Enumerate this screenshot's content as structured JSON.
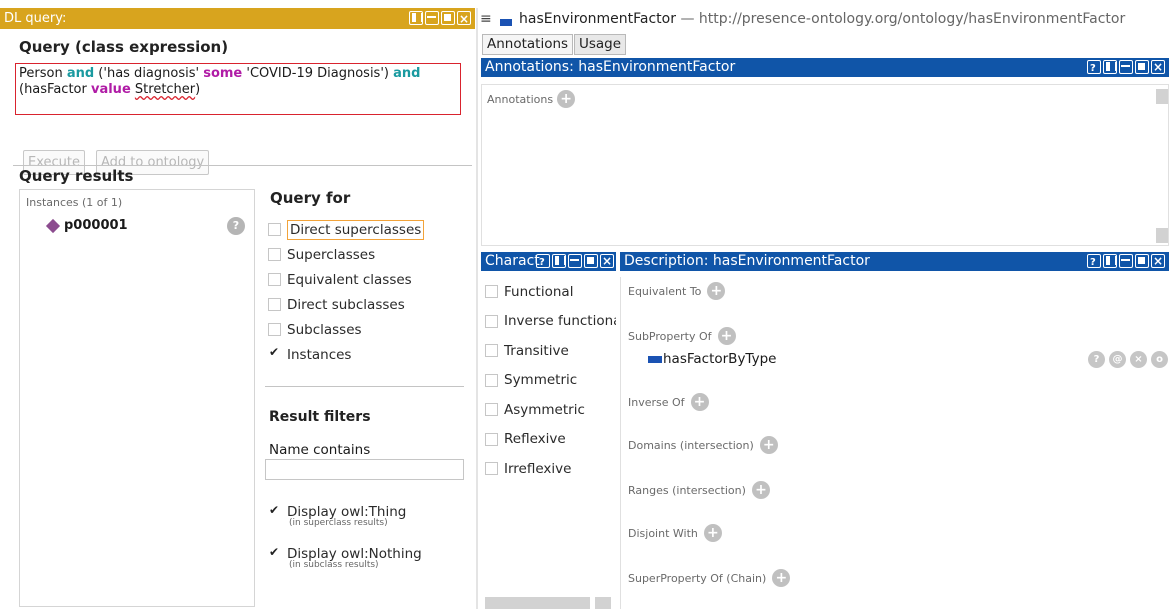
{
  "dl_query": {
    "title": "DL query:",
    "class_expression_heading": "Query (class expression)",
    "expression": {
      "t1": "Person ",
      "k1": "and",
      "t2": " ('has diagnosis' ",
      "k2": "some",
      "t3": " 'COVID-19 Diagnosis') ",
      "k3": "and",
      "t4": "(hasFactor ",
      "k4": "value",
      "t5": " ",
      "t6": "Stretcher",
      "t7": ")"
    },
    "execute_label": "Execute",
    "add_label": "Add to ontology",
    "results_heading": "Query results",
    "instances_header": "Instances (1 of 1)",
    "result_item": "p000001",
    "help_glyph": "?",
    "query_for_heading": "Query for",
    "query_for": [
      {
        "label": "Direct superclasses",
        "checked": false
      },
      {
        "label": "Superclasses",
        "checked": false
      },
      {
        "label": "Equivalent classes",
        "checked": false
      },
      {
        "label": "Direct subclasses",
        "checked": false
      },
      {
        "label": "Subclasses",
        "checked": false
      },
      {
        "label": "Instances",
        "checked": true
      }
    ],
    "result_filters_heading": "Result filters",
    "name_contains_label": "Name contains",
    "name_contains_value": "",
    "display_thing_label": "Display owl:Thing",
    "display_thing_note": "(in superclass results)",
    "display_nothing_label": "Display owl:Nothing",
    "display_nothing_note": "(in subclass results)"
  },
  "header": {
    "menu_glyph": "≡",
    "entity": "hasEnvironmentFactor",
    "separator": " — ",
    "iri": "http://presence-ontology.org/ontology/hasEnvironmentFactor"
  },
  "tabs": [
    {
      "label": "Annotations"
    },
    {
      "label": "Usage"
    }
  ],
  "annotations": {
    "title": "Annotations: hasEnvironmentFactor",
    "label": "Annotations"
  },
  "characteristics": {
    "title": "Charact",
    "items": [
      "Functional",
      "Inverse functiona",
      "Transitive",
      "Symmetric",
      "Asymmetric",
      "Reflexive",
      "Irreflexive"
    ]
  },
  "description": {
    "title": "Description: hasEnvironmentFactor",
    "equivalent_to": "Equivalent To",
    "subproperty_of": "SubProperty Of",
    "subproperty_value": "hasFactorByType",
    "inverse_of": "Inverse Of",
    "domains": "Domains (intersection)",
    "ranges": "Ranges (intersection)",
    "disjoint_with": "Disjoint With",
    "superproperty_chain": "SuperProperty Of (Chain)",
    "row_actions": [
      "?",
      "@",
      "×",
      "o"
    ]
  },
  "colors": {
    "dl_title_bg": "#d8a41e",
    "view_title_bg": "#1055a8",
    "keyword_teal": "#1a9aa0",
    "keyword_purple": "#b01ca6",
    "error_red": "#d9232e",
    "individual_diamond": "#8c4c8f",
    "property_blue": "#1a52b3"
  }
}
